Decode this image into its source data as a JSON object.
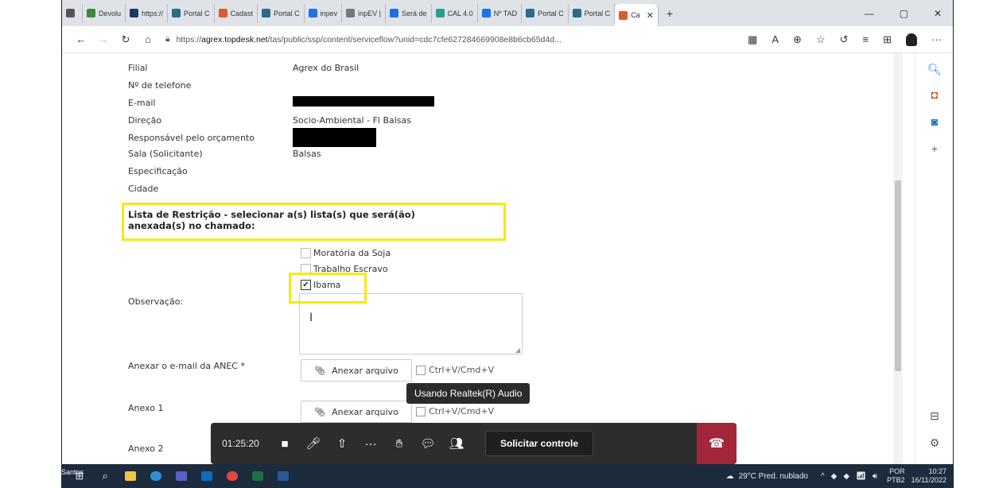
{
  "browser": {
    "tabs": [
      {
        "label": "",
        "color": "#555555"
      },
      {
        "label": "Devolu",
        "color": "#3a8a3a"
      },
      {
        "label": "https://",
        "color": "#1b3a66"
      },
      {
        "label": "Portal C",
        "color": "#2b6c8a"
      },
      {
        "label": "Cadast",
        "color": "#e2582a"
      },
      {
        "label": "Portal C",
        "color": "#2b6c8a"
      },
      {
        "label": "inpev",
        "color": "#1a73e8"
      },
      {
        "label": "inpEV |",
        "color": "#777777"
      },
      {
        "label": "Será de",
        "color": "#1a73e8"
      },
      {
        "label": "CAL 4.0",
        "color": "#2a9d8f"
      },
      {
        "label": "Nº TAD",
        "color": "#1a73e8"
      },
      {
        "label": "Portal C",
        "color": "#2b6c8a"
      },
      {
        "label": "Portal C",
        "color": "#2b6c8a"
      },
      {
        "label": "Ca",
        "color": "#e2582a"
      }
    ],
    "url_prefix": "https://",
    "url_host": "agrex.topdesk.net",
    "url_rest": "/tas/public/ssp/content/serviceflow?unid=cdc7cfe627284669908e8b6cb65d4d...",
    "new_tab": "+",
    "win_min": "—",
    "win_max": "▢",
    "win_close": "✕"
  },
  "form": {
    "fields": [
      {
        "label": "Filial",
        "value": "Agrex do Brasil"
      },
      {
        "label": "Nº de telefone",
        "value": ""
      },
      {
        "label": "E-mail",
        "value": ""
      },
      {
        "label": "Direção",
        "value": "Socio-Ambiental - Fl Balsas"
      },
      {
        "label": "Responsável pelo orçamento",
        "value": ""
      },
      {
        "label": "Sala (Solicitante)",
        "value": "Balsas"
      },
      {
        "label": "Especificação",
        "value": ""
      },
      {
        "label": "Cidade",
        "value": ""
      }
    ],
    "section_title": "Lista de Restrição - selecionar a(s) lista(s) que será(ão) anexada(s) no chamado:",
    "checkboxes": [
      {
        "label": "Moratória da Soja",
        "checked": false
      },
      {
        "label": "Trabalho Escravo",
        "checked": false
      },
      {
        "label": "Ibama",
        "checked": true
      }
    ],
    "observacao_label": "Observação:",
    "anexo_email_label": "Anexar o e-mail da ANEC *",
    "anexo1_label": "Anexo 1",
    "anexo2_label": "Anexo 2",
    "attach_button": "Anexar arquivo",
    "paste_hint": "Ctrl+V/Cmd+V"
  },
  "tooltip": "Usando Realtek(R) Audio",
  "call": {
    "timer": "01:25:20",
    "control_button": "Solicitar controle",
    "accent": "#a3263a"
  },
  "taskbar": {
    "user_label": "Santos",
    "weather": "29°C Pred. nublado",
    "lang1": "POR",
    "lang2": "PTB2",
    "time": "10:27",
    "date": "16/11/2022"
  }
}
